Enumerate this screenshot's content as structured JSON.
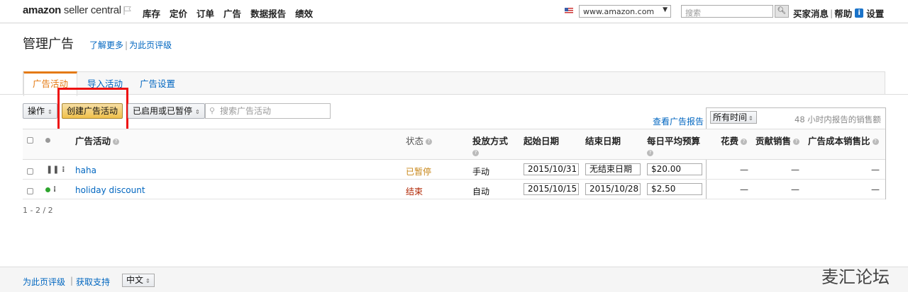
{
  "header": {
    "logo_bold": "amazon",
    "logo_light": " seller central",
    "nav": [
      "库存",
      "定价",
      "订单",
      "广告",
      "数据报告",
      "绩效"
    ],
    "marketplace": "www.amazon.com",
    "search_placeholder": "搜索",
    "links": [
      "买家消息",
      "帮助",
      "设置"
    ]
  },
  "page": {
    "title": "管理广告",
    "learn_more": "了解更多",
    "rate_page": "为此页评级",
    "tabs": [
      "广告活动",
      "导入活动",
      "广告设置"
    ]
  },
  "toolbar": {
    "actions": "操作",
    "create": "创建广告活动",
    "filter": "已启用或已暂停",
    "search_placeholder": "搜索广告活动",
    "view_report": "查看广告报告",
    "time_range": "所有时间",
    "note": "48 小时内报告的销售额"
  },
  "table": {
    "headers": {
      "campaign": "广告活动",
      "status": "状态",
      "targeting": "投放方式",
      "start": "起始日期",
      "end": "结束日期",
      "budget": "每日平均预算",
      "spend": "花费",
      "sales": "贡献销售",
      "acos": "广告成本销售比"
    },
    "rows": [
      {
        "name": "haha",
        "status": "已暂停",
        "targeting": "手动",
        "start": "2015/10/31",
        "end": "无结束日期",
        "budget": "$20.00",
        "spend": "—",
        "sales": "—",
        "acos": "—",
        "state_color": "#555555"
      },
      {
        "name": "holiday discount",
        "status": "结束",
        "targeting": "自动",
        "start": "2015/10/15",
        "end": "2015/10/28",
        "budget": "$2.50",
        "spend": "—",
        "sales": "—",
        "acos": "—",
        "state_color": "#2ea52e"
      }
    ],
    "pager": "1 - 2 / 2"
  },
  "footer": {
    "rate_page": "为此页评级",
    "support": "获取支持",
    "language": "中文"
  },
  "watermark": "麦汇论坛"
}
